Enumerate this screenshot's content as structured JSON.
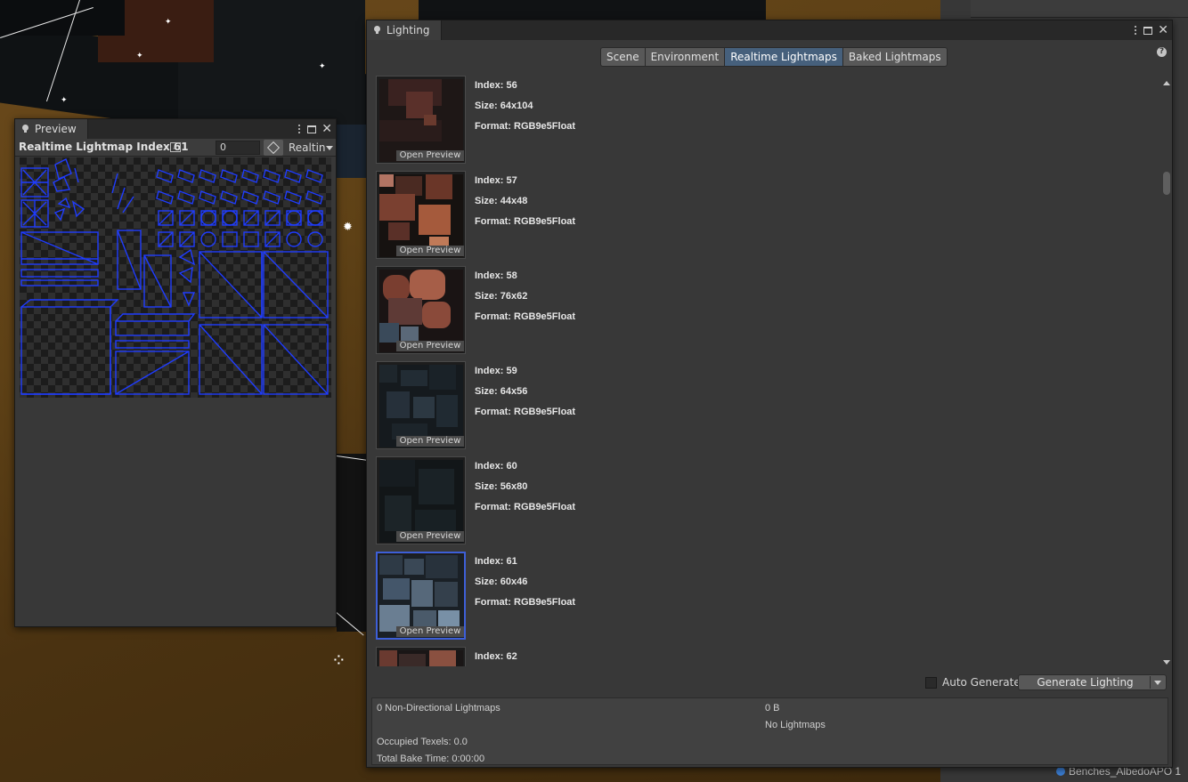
{
  "preview": {
    "tab_title": "Preview",
    "title": "Realtime Lightmap Index 61",
    "mip_value": "0",
    "mode_label": "Realtin"
  },
  "lighting": {
    "tab_title": "Lighting",
    "tabs": [
      {
        "label": "Scene",
        "active": false
      },
      {
        "label": "Environment",
        "active": false
      },
      {
        "label": "Realtime Lightmaps",
        "active": true
      },
      {
        "label": "Baked Lightmaps",
        "active": false
      }
    ],
    "open_preview_label": "Open Preview",
    "lightmaps": [
      {
        "index": "Index: 56",
        "size": "Size: 64x104",
        "format": "Format: RGB9e5Float",
        "selected": false
      },
      {
        "index": "Index: 57",
        "size": "Size: 44x48",
        "format": "Format: RGB9e5Float",
        "selected": false
      },
      {
        "index": "Index: 58",
        "size": "Size: 76x62",
        "format": "Format: RGB9e5Float",
        "selected": false
      },
      {
        "index": "Index: 59",
        "size": "Size: 64x56",
        "format": "Format: RGB9e5Float",
        "selected": false
      },
      {
        "index": "Index: 60",
        "size": "Size: 56x80",
        "format": "Format: RGB9e5Float",
        "selected": false
      },
      {
        "index": "Index: 61",
        "size": "Size: 60x46",
        "format": "Format: RGB9e5Float",
        "selected": true
      },
      {
        "index": "Index: 62",
        "size": "",
        "format": "",
        "selected": false
      }
    ],
    "auto_generate_label": "Auto Generate",
    "auto_generate_checked": false,
    "generate_button": "Generate Lighting",
    "stats": {
      "non_directional": "0 Non-Directional Lightmaps",
      "size": "0 B",
      "no_lightmaps": "No Lightmaps",
      "occupied_texels": "Occupied Texels: 0.0",
      "bake_time": "Total Bake Time: 0:00:00"
    }
  },
  "scene": {
    "hierarchy_item": "Benches_AlbedoAPO 1"
  },
  "colors": {
    "accent": "#46607c",
    "selection_border": "#3d5fd8",
    "uv_wire": "#1f3cff"
  }
}
